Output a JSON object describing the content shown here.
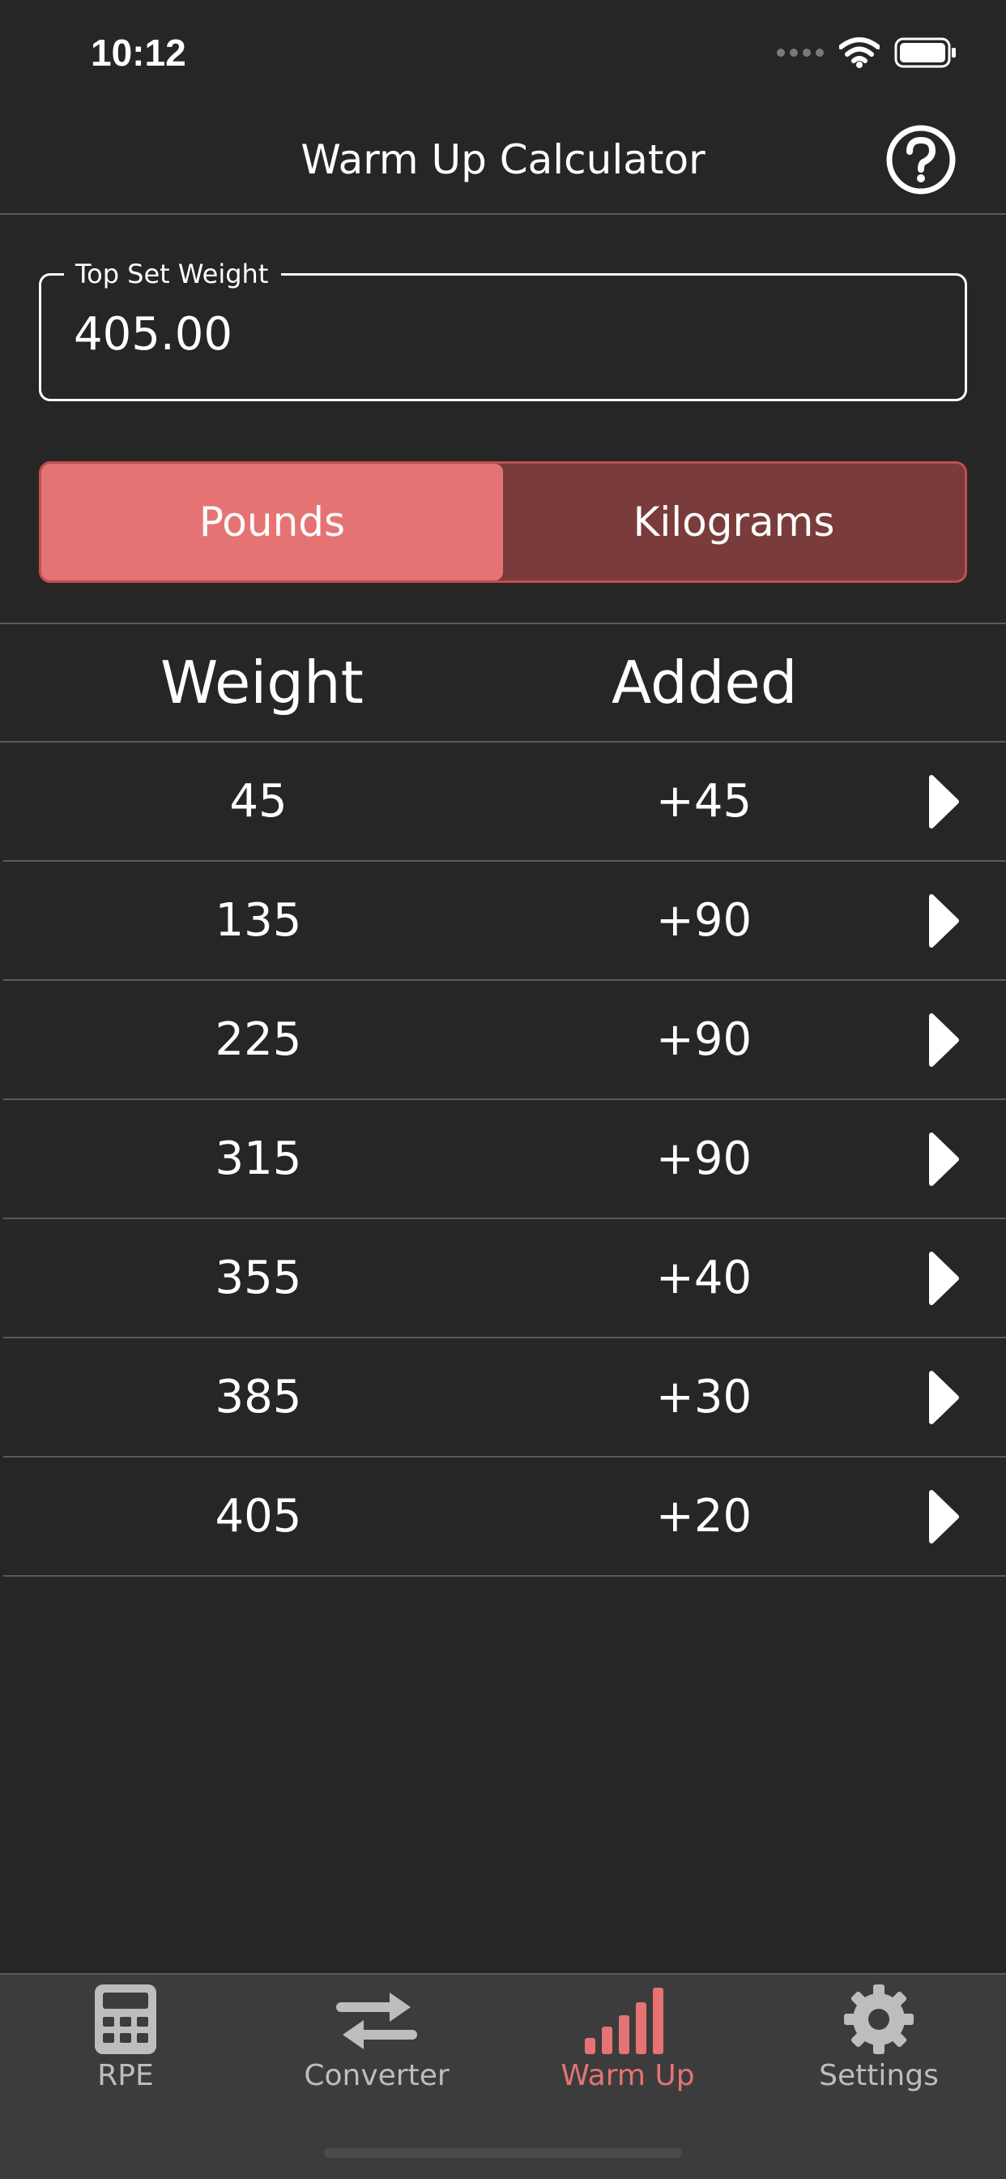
{
  "status_bar": {
    "time": "10:12"
  },
  "header": {
    "title": "Warm Up Calculator",
    "help_icon": "question-circle-icon"
  },
  "top_set": {
    "label": "Top Set Weight",
    "value": "405.00"
  },
  "units": {
    "options": [
      "Pounds",
      "Kilograms"
    ],
    "selected": "Pounds"
  },
  "table": {
    "headers": [
      "Weight",
      "Added"
    ],
    "rows": [
      {
        "weight": "45",
        "added": "+45"
      },
      {
        "weight": "135",
        "added": "+90"
      },
      {
        "weight": "225",
        "added": "+90"
      },
      {
        "weight": "315",
        "added": "+90"
      },
      {
        "weight": "355",
        "added": "+40"
      },
      {
        "weight": "385",
        "added": "+30"
      },
      {
        "weight": "405",
        "added": "+20"
      }
    ]
  },
  "tab_bar": {
    "items": [
      {
        "label": "RPE",
        "icon": "calculator-icon"
      },
      {
        "label": "Converter",
        "icon": "swap-arrows-icon"
      },
      {
        "label": "Warm Up",
        "icon": "bar-chart-icon"
      },
      {
        "label": "Settings",
        "icon": "gear-icon"
      }
    ],
    "selected": "Warm Up"
  },
  "colors": {
    "background": "#262626",
    "accent": "#e57373",
    "segment_inactive": "#7a3b3b",
    "tab_bar": "#3c3c3c",
    "tab_inactive": "#bdbdbd"
  }
}
